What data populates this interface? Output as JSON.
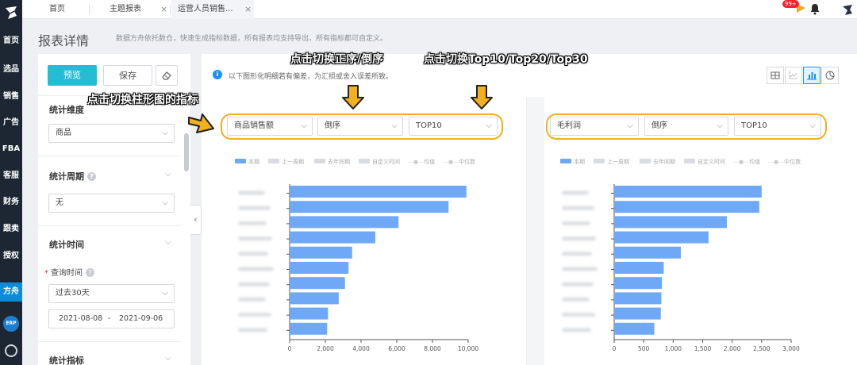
{
  "nav": {
    "items": [
      "首页",
      "选品",
      "销售",
      "广告",
      "FBA",
      "客服",
      "财务",
      "跟卖",
      "授权",
      "方舟"
    ],
    "erp_label": "ERP"
  },
  "tabs": {
    "home": "首页",
    "topic": "主题报表",
    "current": "运营人员销售...",
    "badge": "99+"
  },
  "header": {
    "title": "报表详情",
    "desc": "数据方舟依托数仓，快速生成指标数据，所有报表均支持导出，所有指标都可自定义。"
  },
  "left": {
    "preview": "预览",
    "save": "保存",
    "dimension_label": "统计维度",
    "dimension_value": "商品",
    "period_label": "统计周期",
    "period_value": "无",
    "time_label": "统计时间",
    "query_time_label": "查询时间",
    "query_range": "过去30天",
    "date_start": "2021-08-08",
    "date_sep": "-",
    "date_end": "2021-09-06",
    "metrics_label": "统计指标"
  },
  "main": {
    "info": "以下图形化明细若有偏差，为汇损或舍入误差所致。",
    "left_chart": {
      "metric": "商品销售额",
      "order": "倒序",
      "top": "TOP10"
    },
    "right_chart": {
      "metric": "毛利润",
      "order": "倒序",
      "top": "TOP10"
    }
  },
  "annotations": {
    "switch_order": "点击切换正序/倒序",
    "switch_top": "点击切换Top10/Top20/Top30",
    "switch_metric": "点击切换柱形图的指标"
  },
  "legend": {
    "current": "本期",
    "prev_period": "上一周期",
    "last_year": "去年同期",
    "custom": "自定义时间",
    "mean": "均值",
    "median": "中位数"
  },
  "colors": {
    "bar": "#6fa8f7",
    "accent": "#26bcd6",
    "highlight": "#f2b01e",
    "nav": "#1d2733"
  },
  "chart_data": [
    {
      "type": "bar",
      "orientation": "horizontal",
      "series": [
        {
          "name": "本期",
          "values": [
            9900,
            8900,
            6100,
            4800,
            3500,
            3300,
            3100,
            2750,
            2150,
            2100
          ]
        }
      ],
      "xlim": [
        0,
        10000
      ],
      "xticks": [
        "0",
        "2,000",
        "4,000",
        "6,000",
        "8,000",
        "10,000"
      ],
      "grid": false,
      "legend": "top-left"
    },
    {
      "type": "bar",
      "orientation": "horizontal",
      "series": [
        {
          "name": "本期",
          "values": [
            2500,
            2460,
            1910,
            1600,
            1130,
            840,
            810,
            800,
            790,
            680
          ]
        }
      ],
      "xlim": [
        0,
        3000
      ],
      "xticks": [
        "0",
        "500",
        "1,000",
        "1,500",
        "2,000",
        "2,500",
        "3,000"
      ],
      "grid": false,
      "legend": "top-left"
    }
  ]
}
